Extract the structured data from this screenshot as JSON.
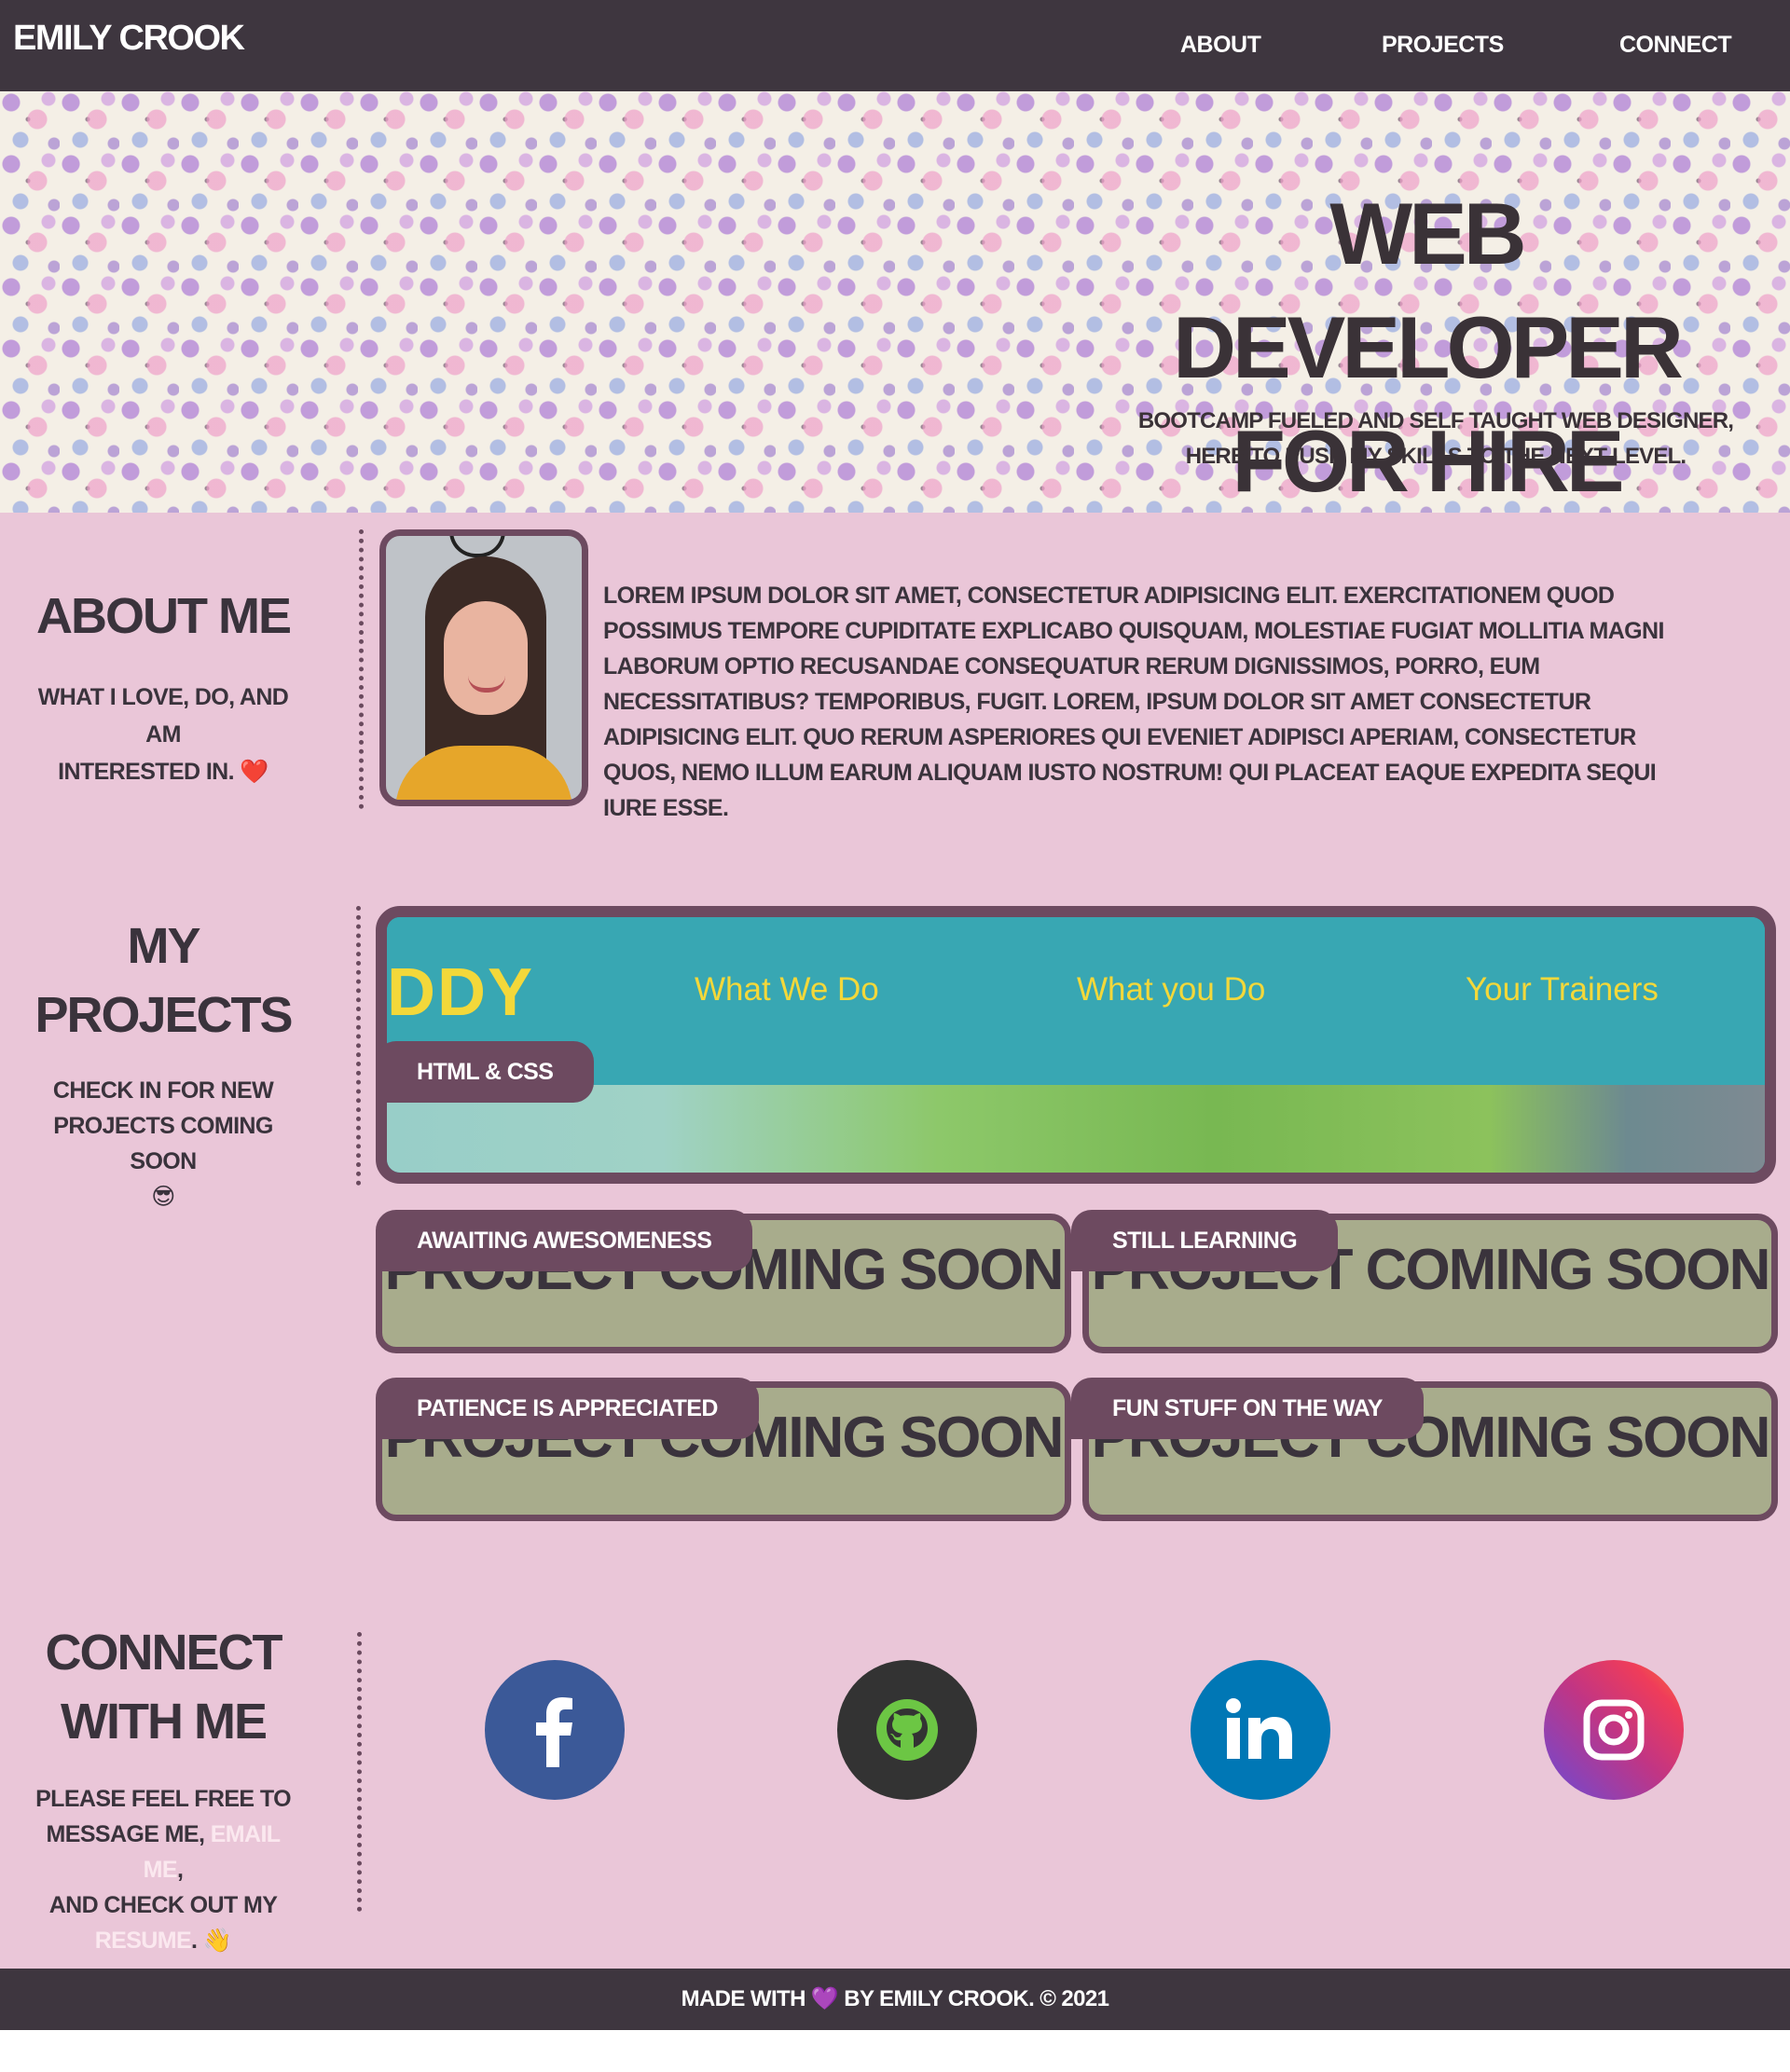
{
  "nav": {
    "brand": "EMILY CROOK",
    "links": [
      "ABOUT",
      "PROJECTS",
      "CONNECT"
    ]
  },
  "hero": {
    "title_line1": "WEB DEVELOPER",
    "title_line2": "FOR HIRE",
    "subtitle_line1": "BOOTCAMP FUELED AND SELF TAUGHT WEB DESIGNER,",
    "subtitle_line2": "HERE TO PUSH MY SKILLS TO THE NEXT LEVEL."
  },
  "about": {
    "title": "ABOUT ME",
    "desc_line1": "WHAT I LOVE, DO, AND AM",
    "desc_line2": "INTERESTED IN.",
    "emoji": "❤️",
    "body": "LOREM IPSUM DOLOR SIT AMET, CONSECTETUR ADIPISICING ELIT. EXERCITATIONEM QUOD POSSIMUS TEMPORE CUPIDITATE EXPLICABO QUISQUAM, MOLESTIAE FUGIAT MOLLITIA MAGNI LABORUM OPTIO RECUSANDAE CONSEQUATUR RERUM DIGNISSIMOS, PORRO, EUM NECESSITATIBUS? TEMPORIBUS, FUGIT. LOREM, IPSUM DOLOR SIT AMET CONSECTETUR ADIPISICING ELIT. QUO RERUM ASPERIORES QUI EVENIET ADIPISCI APERIAM, CONSECTETUR QUOS, NEMO ILLUM EARUM ALIQUAM IUSTO NOSTRUM! QUI PLACEAT EAQUE EXPEDITA SEQUI IURE ESSE."
  },
  "projects": {
    "title_line1": "MY",
    "title_line2": "PROJECTS",
    "desc_line1": "CHECK IN FOR NEW",
    "desc_line2": "PROJECTS COMING SOON",
    "emoji": "😎",
    "featured": {
      "logo": "DDY",
      "links": [
        "What We Do",
        "What you Do",
        "Your Trainers"
      ],
      "badge": "HTML & CSS"
    },
    "placeholders": [
      {
        "badge": "AWAITING AWESOMENESS",
        "text": "PROJECT COMING SOON"
      },
      {
        "badge": "STILL LEARNING",
        "text": "PROJECT COMING SOON"
      },
      {
        "badge": "PATIENCE IS APPRECIATED",
        "text": "PROJECT COMING SOON"
      },
      {
        "badge": "FUN STUFF ON THE WAY",
        "text": "PROJECT COMING SOON"
      }
    ]
  },
  "connect": {
    "title_line1": "CONNECT",
    "title_line2": "WITH ME",
    "desc_line1": "PLEASE FEEL FREE TO",
    "desc_line2_pre": "MESSAGE ME, ",
    "email_link": "EMAIL ME",
    "desc_line2_post": ",",
    "desc_line3": "AND CHECK OUT MY",
    "resume_link": "RESUME",
    "desc_line4_post": ".",
    "emoji": "👋",
    "socials": [
      {
        "name": "facebook-icon",
        "color": "#3b5998"
      },
      {
        "name": "github-icon",
        "color": "#333333"
      },
      {
        "name": "linkedin-icon",
        "color": "#0077b5"
      },
      {
        "name": "instagram-icon",
        "color": "#c13584"
      }
    ]
  },
  "footer": {
    "pre": "MADE WITH",
    "heart": "💜",
    "post": "BY EMILY CROOK. © 2021"
  }
}
